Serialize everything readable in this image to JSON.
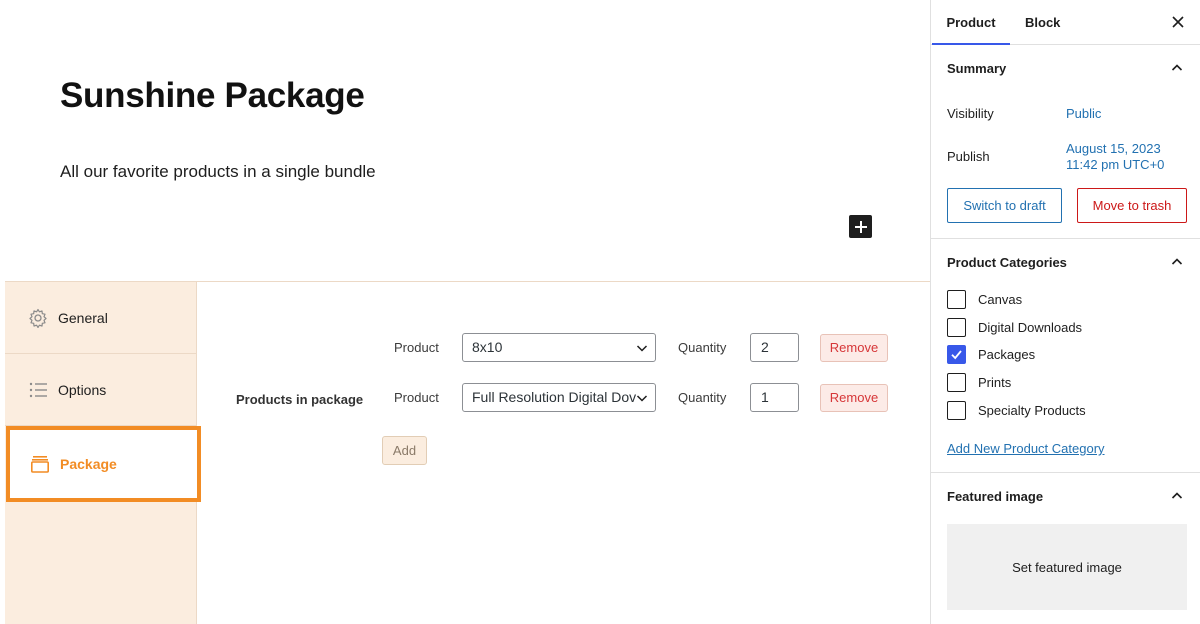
{
  "post": {
    "title": "Sunshine Package",
    "description": "All our favorite products in a single bundle"
  },
  "meta_tabs": [
    {
      "label": "General",
      "icon": "gear-icon"
    },
    {
      "label": "Options",
      "icon": "list-icon"
    },
    {
      "label": "Package",
      "icon": "package-icon",
      "active": true
    }
  ],
  "package": {
    "section_label": "Products in package",
    "rows": [
      {
        "product_label": "Product",
        "product_value": "8x10",
        "quantity_label": "Quantity",
        "quantity_value": "2",
        "remove_label": "Remove"
      },
      {
        "product_label": "Product",
        "product_value": "Full Resolution Digital Dov",
        "quantity_label": "Quantity",
        "quantity_value": "1",
        "remove_label": "Remove"
      }
    ],
    "add_label": "Add"
  },
  "sidebar": {
    "tabs": [
      "Product",
      "Block"
    ],
    "summary": {
      "title": "Summary",
      "visibility_label": "Visibility",
      "visibility_value": "Public",
      "publish_label": "Publish",
      "publish_date": "August 15, 2023",
      "publish_time": "11:42 pm UTC+0",
      "switch_draft_label": "Switch to draft",
      "trash_label": "Move to trash"
    },
    "categories": {
      "title": "Product Categories",
      "items": [
        {
          "label": "Canvas",
          "checked": false
        },
        {
          "label": "Digital Downloads",
          "checked": false
        },
        {
          "label": "Packages",
          "checked": true
        },
        {
          "label": "Prints",
          "checked": false
        },
        {
          "label": "Specialty Products",
          "checked": false
        }
      ],
      "add_new_label": "Add New Product Category"
    },
    "featured_image": {
      "title": "Featured image",
      "set_label": "Set featured image"
    }
  },
  "colors": {
    "accent": "#f28c24",
    "link": "#2271b1",
    "danger": "#cc1818",
    "checkbox": "#3858e9",
    "panel_bg": "#fbeddf"
  }
}
